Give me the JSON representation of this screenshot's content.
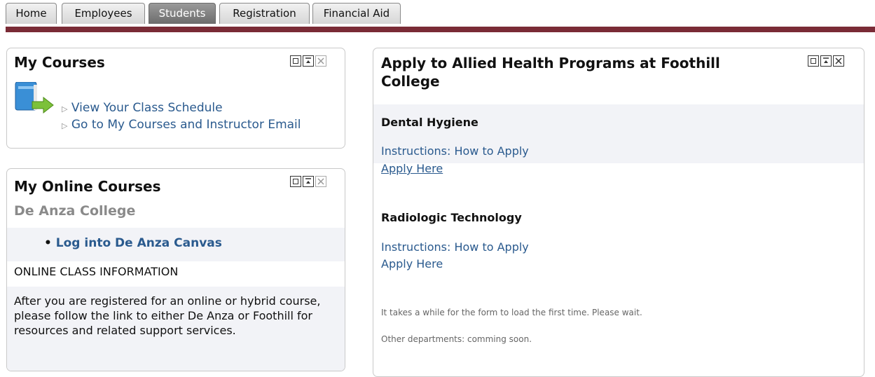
{
  "tabs": [
    {
      "label": "Home",
      "active": false
    },
    {
      "label": "Employees",
      "active": false
    },
    {
      "label": "Students",
      "active": true
    },
    {
      "label": "Registration",
      "active": false
    },
    {
      "label": "Financial Aid",
      "active": false
    }
  ],
  "my_courses": {
    "title": "My Courses",
    "links": [
      "View Your Class Schedule",
      "Go to My Courses and Instructor Email"
    ]
  },
  "my_online": {
    "title": "My Online Courses",
    "college": "De Anza College",
    "canvas_link": "Log into De Anza Canvas",
    "info_heading": "ONLINE CLASS INFORMATION",
    "info_text": "After you are registered for an online or hybrid course, please follow the link to either De Anza or Foothill for resources and related support services."
  },
  "allied": {
    "title": "Apply to Allied Health Programs at Foothill College",
    "programs": [
      {
        "name": "Dental Hygiene",
        "instructions": "Instructions: How to Apply",
        "apply": "Apply Here"
      },
      {
        "name": "Radiologic Technology",
        "instructions": "Instructions: How to Apply",
        "apply": "Apply Here"
      }
    ],
    "note1": "It takes a while for the form to load the first time. Please wait.",
    "note2": "Other departments: comming soon."
  },
  "colors": {
    "tab_line": "#7a2b36",
    "link": "#2a5a8e",
    "active_tab": "#6c6c6c"
  }
}
